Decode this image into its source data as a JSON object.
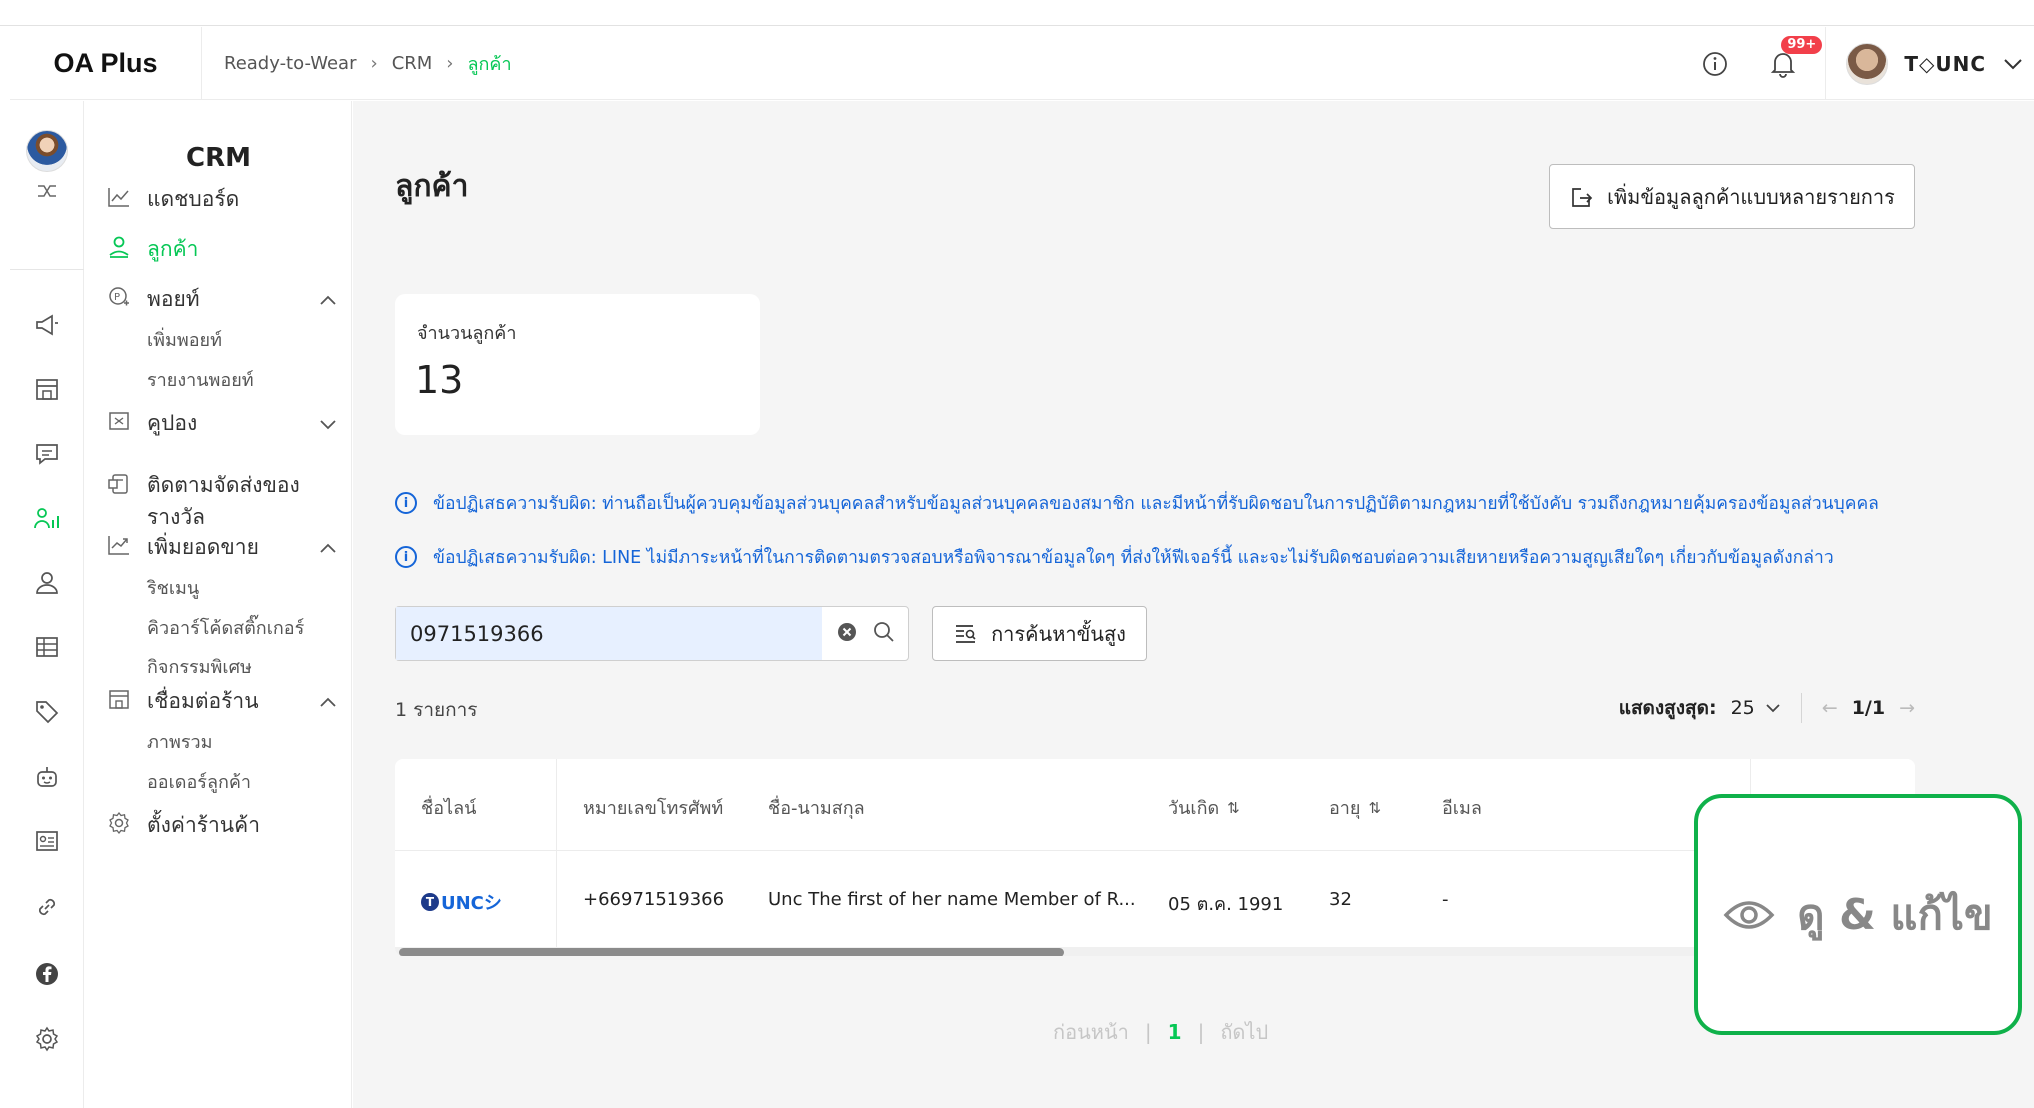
{
  "header": {
    "logo": "OA Plus",
    "breadcrumb": [
      "Ready-to-Wear",
      "CRM",
      "ลูกค้า"
    ],
    "notification_badge": "99+",
    "user_name": "T◇UNC"
  },
  "sidebar": {
    "title": "CRM",
    "items": [
      {
        "label": "แดชบอร์ด",
        "icon": "chart-line-icon"
      },
      {
        "label": "ลูกค้า",
        "icon": "users-icon",
        "active": true
      },
      {
        "label": "พอยท์",
        "icon": "point-icon",
        "expanded": true,
        "sub": [
          "เพิ่มพอยท์",
          "รายงานพอยท์"
        ]
      },
      {
        "label": "คูปอง",
        "icon": "coupon-icon",
        "expanded": false
      },
      {
        "label": "ติดตามจัดส่งของรางวัล",
        "line1": "ติดตามจัดส่งของ",
        "line2": "รางวัล",
        "icon": "gift-track-icon"
      },
      {
        "label": "เพิ่มยอดขาย",
        "icon": "sales-chart-icon",
        "expanded": true,
        "sub": [
          "ริชเมนู",
          "คิวอาร์โค้ดสติ๊กเกอร์",
          "กิจกรรมพิเศษ"
        ]
      },
      {
        "label": "เชื่อมต่อร้าน",
        "icon": "store-icon",
        "expanded": true,
        "sub": [
          "ภาพรวม",
          "ออเดอร์ลูกค้า"
        ]
      },
      {
        "label": "ตั้งค่าร้านค้า",
        "icon": "settings-icon"
      }
    ]
  },
  "main": {
    "title": "ลูกค้า",
    "bulk_add_label": "เพิ่มข้อมูลลูกค้าแบบหลายรายการ",
    "stat_label": "จำนวนลูกค้า",
    "stat_value": "13",
    "notice1": "ข้อปฏิเสธความรับผิด: ท่านถือเป็นผู้ควบคุมข้อมูลส่วนบุคคลสำหรับข้อมูลส่วนบุคคลของสมาชิก และมีหน้าที่รับผิดชอบในการปฏิบัติตามกฎหมายที่ใช้บังคับ รวมถึงกฎหมายคุ้มครองข้อมูลส่วนบุคคล",
    "notice2": "ข้อปฏิเสธความรับผิด: LINE ไม่มีภาระหน้าที่ในการติดตามตรวจสอบหรือพิจารณาข้อมูลใดๆ ที่ส่งให้ฟีเจอร์นี้ และจะไม่รับผิดชอบต่อความเสียหายหรือความสูญเสียใดๆ เกี่ยวกับข้อมูลดังกล่าว",
    "search_value": "0971519366",
    "advanced_search_label": "การค้นหาขั้นสูง",
    "count_text": "1 รายการ",
    "page_size_label": "แสดงสูงสุด:",
    "page_size_value": "25",
    "page_indicator": "1/1"
  },
  "table": {
    "columns": [
      "ชื่อไลน์",
      "หมายเลขโทรศัพท์",
      "ชื่อ-นามสกุล",
      "วันเกิด",
      "อายุ",
      "อีเมล"
    ],
    "rows": [
      {
        "line_name": "UNCシ",
        "phone": "+66971519366",
        "full_name": "Unc The first of her name Member of R...",
        "birthday": "05 ต.ค. 1991",
        "age": "32",
        "email": "-"
      }
    ]
  },
  "pagination": {
    "prev": "ก่อนหน้า",
    "current": "1",
    "next": "ถัดไป"
  },
  "action": {
    "view_edit_label": "ดู & แก้ไข"
  },
  "colors": {
    "accent": "#06c755",
    "link": "#1565d8",
    "highlight": "#0fb14a"
  }
}
